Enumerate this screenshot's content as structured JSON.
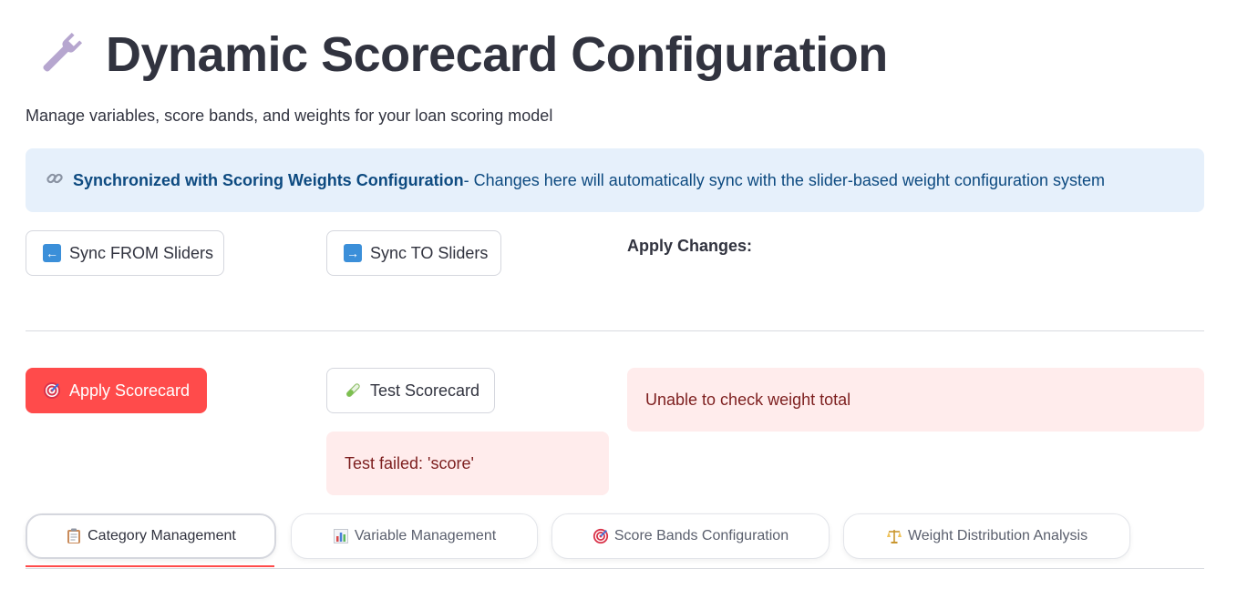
{
  "header": {
    "icon": "wrench-icon",
    "title": "Dynamic Scorecard Configuration",
    "subtitle": "Manage variables, score bands, and weights for your loan scoring model"
  },
  "info": {
    "icon": "link-icon",
    "bold": "Synchronized with Scoring Weights Configuration",
    "text": " - Changes here will automatically sync with the slider-based weight configuration system"
  },
  "sync": {
    "from_label": "Sync FROM Sliders",
    "from_icon": "left-arrow-icon",
    "to_label": "Sync TO Sliders",
    "to_icon": "right-arrow-icon"
  },
  "apply_changes_label": "Apply Changes:",
  "actions": {
    "apply_label": "Apply Scorecard",
    "apply_icon": "target-icon",
    "test_label": "Test Scorecard",
    "test_icon": "test-tube-icon"
  },
  "alerts": {
    "test_failed": "Test failed: 'score'",
    "weight_check": "Unable to check weight total"
  },
  "tabs": [
    {
      "label": "Category Management",
      "icon": "clipboard-icon",
      "active": true
    },
    {
      "label": "Variable Management",
      "icon": "bar-chart-icon",
      "active": false
    },
    {
      "label": "Score Bands Configuration",
      "icon": "target-icon",
      "active": false
    },
    {
      "label": "Weight Distribution Analysis",
      "icon": "scales-icon",
      "active": false
    }
  ],
  "colors": {
    "primary": "#ff4b4b",
    "info_bg": "#e6f0fb",
    "info_text": "#0d4a80",
    "error_bg": "#ffecec",
    "error_text": "#7d1f1f"
  }
}
